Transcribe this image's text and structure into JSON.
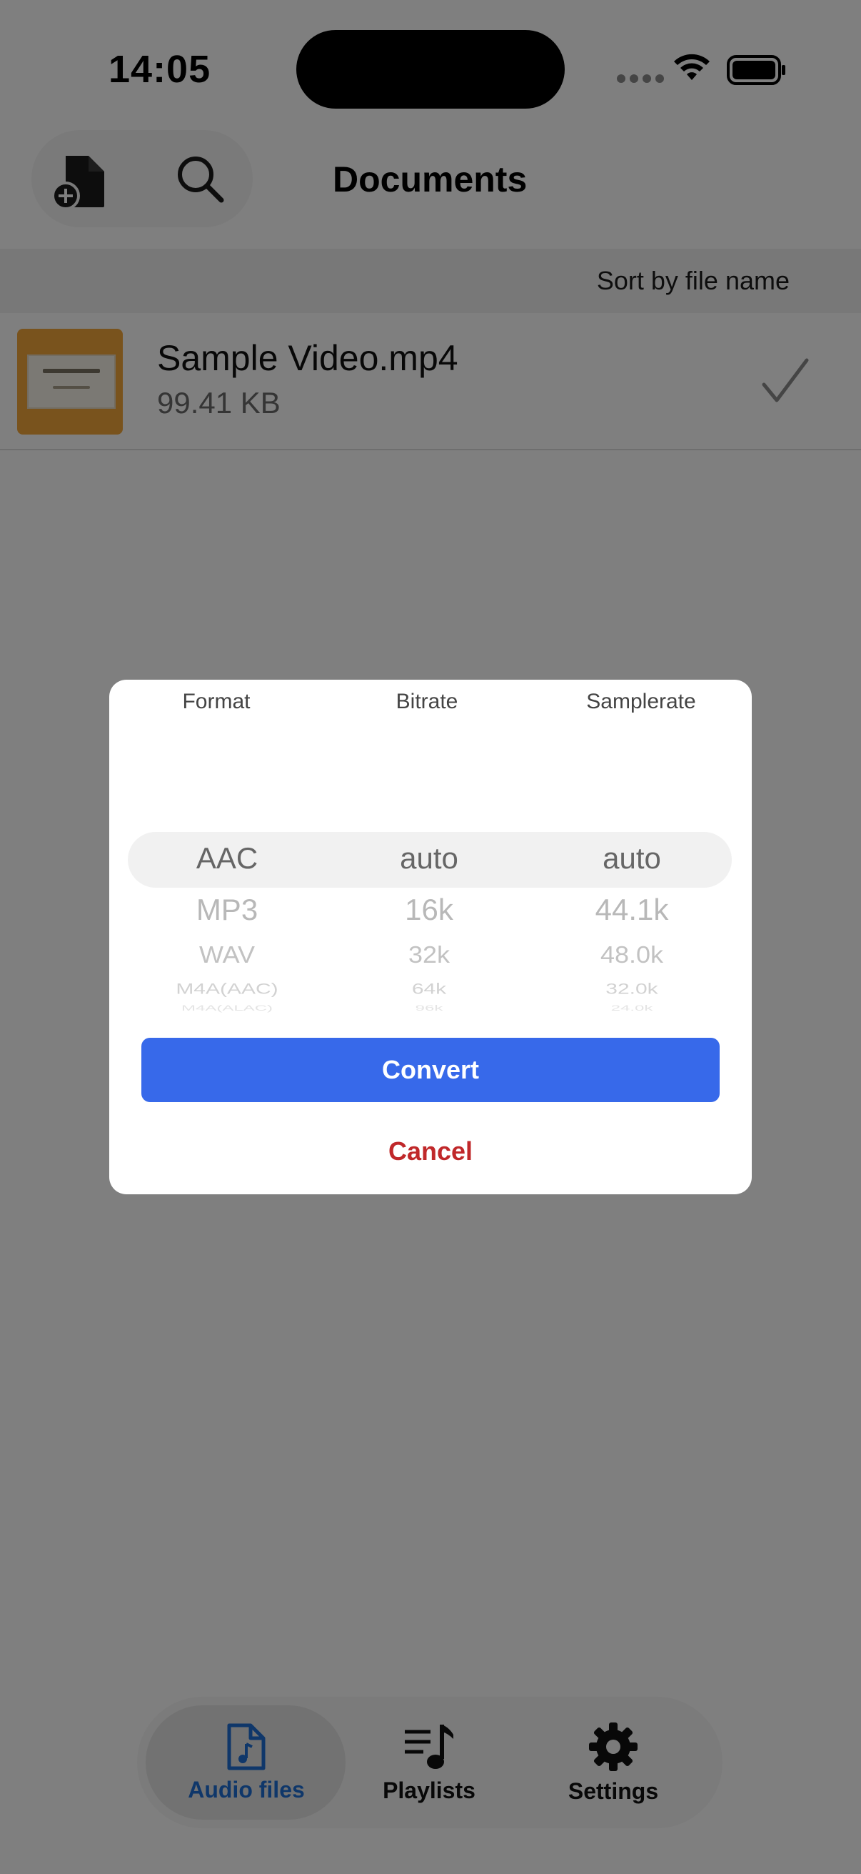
{
  "status_bar": {
    "time": "14:05"
  },
  "header": {
    "title": "Documents"
  },
  "sort": {
    "label": "Sort by file name"
  },
  "files": [
    {
      "name": "Sample Video.mp4",
      "size": "99.41 KB"
    }
  ],
  "dialog": {
    "columns": [
      {
        "header": "Format",
        "selected": "AAC",
        "options": [
          "MP3",
          "WAV",
          "M4A(AAC)",
          "M4A(ALAC)"
        ]
      },
      {
        "header": "Bitrate",
        "selected": "auto",
        "options": [
          "16k",
          "32k",
          "64k",
          "96k"
        ]
      },
      {
        "header": "Samplerate",
        "selected": "auto",
        "options": [
          "44.1k",
          "48.0k",
          "32.0k",
          "24.0k"
        ]
      }
    ],
    "convert_label": "Convert",
    "cancel_label": "Cancel"
  },
  "tabbar": {
    "tabs": [
      {
        "label": "Audio files",
        "icon": "audio-file-icon",
        "active": true
      },
      {
        "label": "Playlists",
        "icon": "playlist-icon",
        "active": false
      },
      {
        "label": "Settings",
        "icon": "gear-icon",
        "active": false
      }
    ]
  },
  "colors": {
    "accent": "#3769ea",
    "cancel": "#c0282a",
    "active_tab": "#1f6fd4"
  }
}
